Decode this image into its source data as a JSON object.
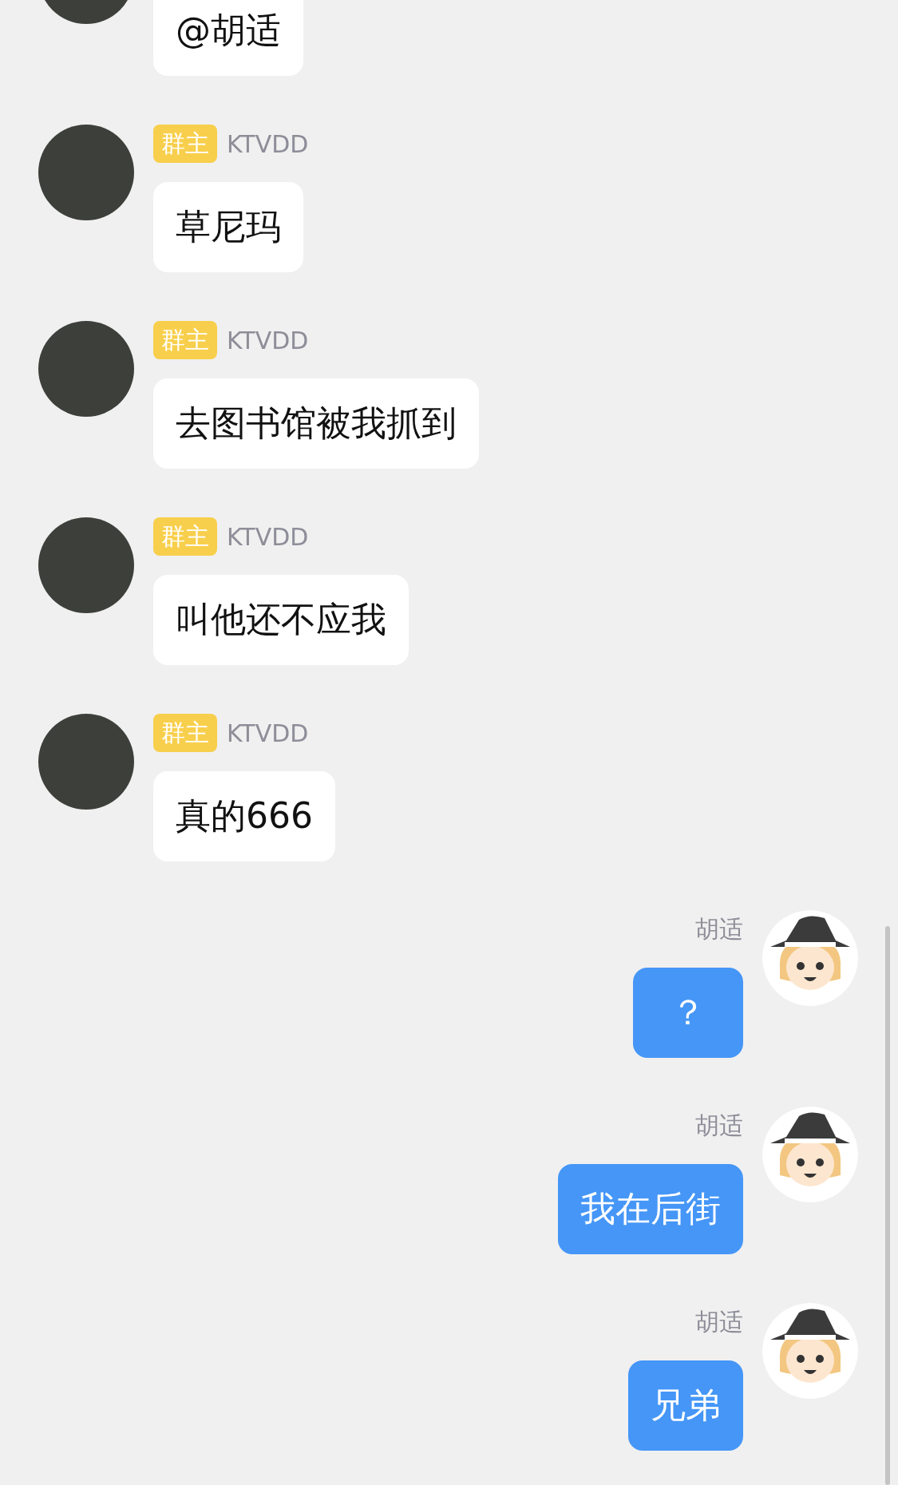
{
  "messages": [
    {
      "kind": "incoming",
      "avatar": {
        "kind": "photo"
      },
      "text": "@胡适"
    },
    {
      "kind": "incoming",
      "avatar": {
        "kind": "photo"
      },
      "badge": "群主",
      "sender": "KTVDD",
      "text": "草尼玛"
    },
    {
      "kind": "incoming",
      "avatar": {
        "kind": "photo"
      },
      "badge": "群主",
      "sender": "KTVDD",
      "text": "去图书馆被我抓到"
    },
    {
      "kind": "incoming",
      "avatar": {
        "kind": "photo"
      },
      "badge": "群主",
      "sender": "KTVDD",
      "text": "叫他还不应我"
    },
    {
      "kind": "incoming",
      "avatar": {
        "kind": "photo"
      },
      "badge": "群主",
      "sender": "KTVDD",
      "text": "真的666"
    },
    {
      "kind": "outgoing",
      "avatar": {
        "kind": "cartoon"
      },
      "sender": "胡适",
      "text": "？"
    },
    {
      "kind": "outgoing",
      "avatar": {
        "kind": "cartoon"
      },
      "sender": "胡适",
      "text": "我在后街"
    },
    {
      "kind": "outgoing",
      "avatar": {
        "kind": "cartoon"
      },
      "sender": "胡适",
      "text": "兄弟"
    }
  ]
}
